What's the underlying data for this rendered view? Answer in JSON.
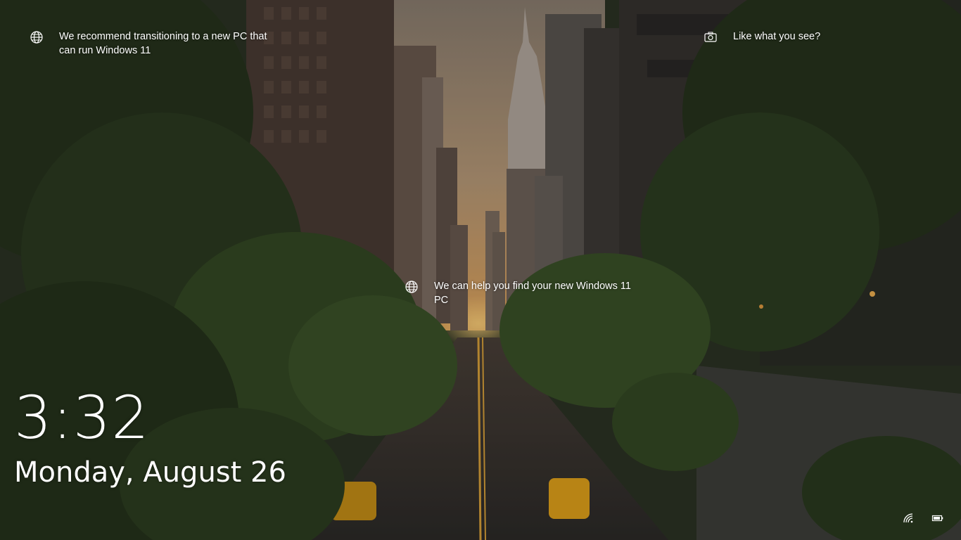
{
  "spotlight": {
    "items": [
      {
        "icon": "globe-icon",
        "text": "We recommend transitioning to a new PC that can run Windows 11"
      },
      {
        "icon": "globe-icon",
        "text": "We can help you find your new Windows 11 PC"
      }
    ],
    "feedback": {
      "icon": "camera-icon",
      "text": "Like what you see?"
    }
  },
  "lock_screen": {
    "time": "3:32",
    "date": "Monday, August 26"
  },
  "tray": {
    "network_icon": "wifi-signal-icon",
    "battery_icon": "battery-icon"
  },
  "colors": {
    "text": "#ffffff",
    "sky_glow": "#c9a37a",
    "foliage": "#2e3d22"
  }
}
